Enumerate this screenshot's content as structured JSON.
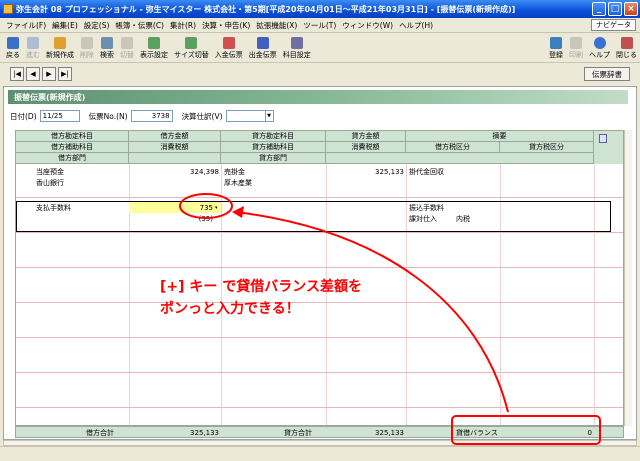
{
  "window": {
    "title": "弥生会計 08 プロフェッショナル - 弥生マイスター 株式会社・第5期[平成20年04月01日～平成21年03月31日] - [振替伝票(新規作成)]"
  },
  "menu": [
    "ファイル(F)",
    "編集(E)",
    "設定(S)",
    "帳簿・伝票(C)",
    "集計(R)",
    "決算・申告(K)",
    "拡張機能(X)",
    "ツール(T)",
    "ウィンドウ(W)",
    "ヘルプ(H)"
  ],
  "navi_label": "ナビゲータ",
  "toolbar": {
    "left": [
      {
        "label": "戻る",
        "enabled": true
      },
      {
        "label": "進む",
        "enabled": false
      },
      {
        "label": "新規作成",
        "enabled": true
      },
      {
        "label": "削除",
        "enabled": false
      },
      {
        "label": "検索",
        "enabled": true
      },
      {
        "label": "切替",
        "enabled": false
      },
      {
        "label": "表示設定",
        "enabled": true
      },
      {
        "label": "サイズ切替",
        "enabled": true
      },
      {
        "label": "入金伝票",
        "enabled": true
      },
      {
        "label": "出金伝票",
        "enabled": true
      },
      {
        "label": "科目設定",
        "enabled": true
      }
    ],
    "right": [
      {
        "label": "登録",
        "enabled": true
      },
      {
        "label": "印刷",
        "enabled": false
      },
      {
        "label": "ヘルプ",
        "enabled": true
      },
      {
        "label": "閉じる",
        "enabled": true
      }
    ]
  },
  "nav": {
    "first": "|◀",
    "prev": "◀",
    "next": "▶",
    "last": "▶|",
    "dict": "伝票辞書"
  },
  "form_title": "振替伝票(新規作成)",
  "header": {
    "date_label": "日付(D)",
    "date_value": "11/25",
    "no_label": "伝票No.(N)",
    "no_value": "3738",
    "settlement_label": "決算仕訳(V)",
    "settlement_value": ""
  },
  "columns": {
    "row1": [
      "借方勘定科目",
      "借方金額",
      "貸方勘定科目",
      "貸方金額",
      "摘要"
    ],
    "row2": [
      "借方補助科目",
      "消費税額",
      "貸方補助科目",
      "消費税額",
      "借方税区分",
      "貸方税区分"
    ],
    "row3": [
      "借方部門",
      "貸方部門"
    ]
  },
  "entries": [
    {
      "debit_account": "当座預金",
      "debit_sub": "香山銀行",
      "debit_amount": "324,398",
      "credit_account": "売掛金",
      "credit_sub": "厚木産業",
      "credit_amount": "325,133",
      "memo": "掛代金回収",
      "debit_tax_type": "",
      "debit_tax": ""
    },
    {
      "debit_account": "支払手数料",
      "debit_sub": "",
      "debit_amount": "735",
      "debit_tax": "(35)",
      "credit_account": "",
      "credit_sub": "",
      "credit_amount": "",
      "memo": "振込手数料",
      "debit_tax_type": "課対仕入",
      "debit_tax_mode": "内税"
    }
  ],
  "footer": {
    "debit_total_label": "借方合計",
    "debit_total": "325,133",
    "credit_total_label": "貸方合計",
    "credit_total": "325,133",
    "balance_label": "貸借バランス",
    "balance": "0"
  },
  "annotation": {
    "line1": "[+] キー で貸借バランス差額を",
    "line2": "ポンっと入力できる！"
  },
  "colors": {
    "accent": "#ff0000",
    "header_bg": "#cfe3d3",
    "title_bar": "#0a4fd8"
  }
}
